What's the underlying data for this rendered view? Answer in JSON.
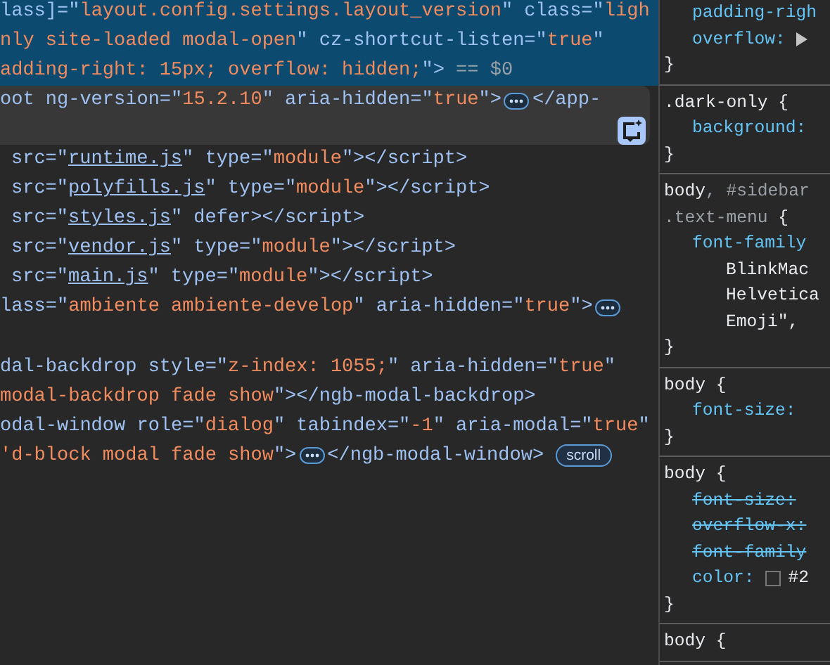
{
  "elements_panel": {
    "lines": [
      {
        "selected": true,
        "hovered": false,
        "indented": false,
        "blank_line_after": false,
        "tokens": [
          {
            "kind": "attr",
            "text": "lass]=\""
          },
          {
            "kind": "value",
            "text": "layout.config.settings.layout_version"
          },
          {
            "kind": "attr",
            "text": "\" class=\""
          },
          {
            "kind": "value",
            "text": "ligh"
          }
        ]
      },
      {
        "selected": true,
        "hovered": false,
        "indented": false,
        "blank_line_after": false,
        "tokens": [
          {
            "kind": "value",
            "text": "nly site-loaded modal-open"
          },
          {
            "kind": "attr",
            "text": "\" cz-shortcut-listen=\""
          },
          {
            "kind": "value",
            "text": "true"
          },
          {
            "kind": "attr",
            "text": "\""
          }
        ]
      },
      {
        "selected": true,
        "hovered": false,
        "indented": false,
        "blank_line_after": false,
        "tokens": [
          {
            "kind": "value",
            "text": "adding-right: 15px; overflow: hidden;"
          },
          {
            "kind": "attr",
            "text": "\">"
          },
          {
            "kind": "ref",
            "text": " == $0"
          }
        ]
      },
      {
        "selected": false,
        "hovered": true,
        "indented": false,
        "blank_line_after": false,
        "tokens": [
          {
            "kind": "attr",
            "text": "oot ng-version=\""
          },
          {
            "kind": "value",
            "text": "15.2.10"
          },
          {
            "kind": "attr",
            "text": "\" aria-hidden=\""
          },
          {
            "kind": "value",
            "text": "true"
          },
          {
            "kind": "attr",
            "text": "\">"
          },
          {
            "kind": "more"
          },
          {
            "kind": "tag",
            "text": "</app-"
          }
        ]
      },
      {
        "selected": false,
        "hovered": false,
        "indented": true,
        "blank_line_after": false,
        "tokens": [
          {
            "kind": "attr",
            "text": "src=\""
          },
          {
            "kind": "link",
            "text": "runtime.js"
          },
          {
            "kind": "attr",
            "text": "\" type=\""
          },
          {
            "kind": "value",
            "text": "module"
          },
          {
            "kind": "attr",
            "text": "\"></script>"
          }
        ]
      },
      {
        "selected": false,
        "hovered": false,
        "indented": true,
        "blank_line_after": false,
        "tokens": [
          {
            "kind": "attr",
            "text": "src=\""
          },
          {
            "kind": "link",
            "text": "polyfills.js"
          },
          {
            "kind": "attr",
            "text": "\" type=\""
          },
          {
            "kind": "value",
            "text": "module"
          },
          {
            "kind": "attr",
            "text": "\"></script>"
          }
        ]
      },
      {
        "selected": false,
        "hovered": false,
        "indented": true,
        "blank_line_after": false,
        "tokens": [
          {
            "kind": "attr",
            "text": "src=\""
          },
          {
            "kind": "link",
            "text": "styles.js"
          },
          {
            "kind": "attr",
            "text": "\" defer></script>"
          }
        ]
      },
      {
        "selected": false,
        "hovered": false,
        "indented": true,
        "blank_line_after": false,
        "tokens": [
          {
            "kind": "attr",
            "text": "src=\""
          },
          {
            "kind": "link",
            "text": "vendor.js"
          },
          {
            "kind": "attr",
            "text": "\" type=\""
          },
          {
            "kind": "value",
            "text": "module"
          },
          {
            "kind": "attr",
            "text": "\"></script>"
          }
        ]
      },
      {
        "selected": false,
        "hovered": false,
        "indented": true,
        "blank_line_after": false,
        "tokens": [
          {
            "kind": "attr",
            "text": "src=\""
          },
          {
            "kind": "link",
            "text": "main.js"
          },
          {
            "kind": "attr",
            "text": "\" type=\""
          },
          {
            "kind": "value",
            "text": "module"
          },
          {
            "kind": "attr",
            "text": "\"></script>"
          }
        ]
      },
      {
        "selected": false,
        "hovered": false,
        "indented": false,
        "blank_line_after": true,
        "tokens": [
          {
            "kind": "attr",
            "text": "lass=\""
          },
          {
            "kind": "value",
            "text": "ambiente ambiente-develop"
          },
          {
            "kind": "attr",
            "text": "\" aria-hidden=\""
          },
          {
            "kind": "value",
            "text": "true"
          },
          {
            "kind": "attr",
            "text": "\">"
          },
          {
            "kind": "more"
          }
        ]
      },
      {
        "selected": false,
        "hovered": false,
        "indented": false,
        "blank_line_after": false,
        "tokens": [
          {
            "kind": "attr",
            "text": "dal-backdrop style=\""
          },
          {
            "kind": "value",
            "text": "z-index: 1055;"
          },
          {
            "kind": "attr",
            "text": "\" aria-hidden=\""
          },
          {
            "kind": "value",
            "text": "true"
          },
          {
            "kind": "attr",
            "text": "\""
          }
        ]
      },
      {
        "selected": false,
        "hovered": false,
        "indented": false,
        "blank_line_after": false,
        "tokens": [
          {
            "kind": "value",
            "text": "modal-backdrop fade show"
          },
          {
            "kind": "attr",
            "text": "\"></ngb-modal-backdrop>"
          }
        ]
      },
      {
        "selected": false,
        "hovered": false,
        "indented": false,
        "blank_line_after": false,
        "tokens": [
          {
            "kind": "attr",
            "text": "odal-window role=\""
          },
          {
            "kind": "value",
            "text": "dialog"
          },
          {
            "kind": "attr",
            "text": "\" tabindex=\""
          },
          {
            "kind": "value",
            "text": "-1"
          },
          {
            "kind": "attr",
            "text": "\" aria-modal=\""
          },
          {
            "kind": "value",
            "text": "true"
          },
          {
            "kind": "attr",
            "text": "\""
          }
        ]
      },
      {
        "selected": false,
        "hovered": false,
        "indented": false,
        "blank_line_after": false,
        "tokens": [
          {
            "kind": "value",
            "text": "'d-block modal fade show"
          },
          {
            "kind": "attr",
            "text": "\">"
          },
          {
            "kind": "more"
          },
          {
            "kind": "tag",
            "text": "</ngb-modal-window>"
          },
          {
            "kind": "badge",
            "text": "scroll"
          }
        ]
      }
    ]
  },
  "styles_panel": {
    "rules": [
      {
        "lines": [
          {
            "kind": "decl",
            "parts": [
              {
                "kind": "prop",
                "text": "padding-righ"
              }
            ]
          },
          {
            "kind": "decl",
            "parts": [
              {
                "kind": "prop",
                "text": "overflow:"
              },
              {
                "kind": "expand"
              }
            ]
          },
          {
            "kind": "close",
            "parts": [
              {
                "kind": "brace",
                "text": "}"
              }
            ]
          }
        ]
      },
      {
        "lines": [
          {
            "kind": "sel",
            "parts": [
              {
                "kind": "sel",
                "text": ".dark-only {"
              }
            ]
          },
          {
            "kind": "decl",
            "parts": [
              {
                "kind": "prop",
                "text": "background:"
              }
            ]
          },
          {
            "kind": "close",
            "parts": [
              {
                "kind": "brace",
                "text": "}"
              }
            ]
          }
        ]
      },
      {
        "lines": [
          {
            "kind": "sel",
            "parts": [
              {
                "kind": "sel",
                "text": "body"
              },
              {
                "kind": "dim",
                "text": ", #sidebar"
              }
            ]
          },
          {
            "kind": "sel",
            "parts": [
              {
                "kind": "dim",
                "text": ".text-menu"
              },
              {
                "kind": "sel",
                "text": " {"
              }
            ]
          },
          {
            "kind": "decl",
            "parts": [
              {
                "kind": "prop",
                "text": "font-family"
              }
            ]
          },
          {
            "kind": "cont",
            "parts": [
              {
                "kind": "plain",
                "text": "BlinkMac"
              }
            ]
          },
          {
            "kind": "cont",
            "parts": [
              {
                "kind": "plain",
                "text": "Helvetica"
              }
            ]
          },
          {
            "kind": "cont",
            "parts": [
              {
                "kind": "plain",
                "text": "Emoji\", "
              }
            ]
          },
          {
            "kind": "close",
            "parts": [
              {
                "kind": "brace",
                "text": "}"
              }
            ]
          }
        ]
      },
      {
        "lines": [
          {
            "kind": "sel",
            "parts": [
              {
                "kind": "sel",
                "text": "body {"
              }
            ]
          },
          {
            "kind": "decl",
            "parts": [
              {
                "kind": "prop",
                "text": "font-size:"
              }
            ]
          },
          {
            "kind": "close",
            "parts": [
              {
                "kind": "brace",
                "text": "}"
              }
            ]
          }
        ]
      },
      {
        "lines": [
          {
            "kind": "sel",
            "parts": [
              {
                "kind": "sel",
                "text": "body {"
              }
            ]
          },
          {
            "kind": "decl",
            "struck": true,
            "parts": [
              {
                "kind": "prop",
                "text": "font-size:"
              }
            ]
          },
          {
            "kind": "decl",
            "struck": true,
            "parts": [
              {
                "kind": "prop",
                "text": "overflow-x:"
              }
            ]
          },
          {
            "kind": "decl",
            "struck": true,
            "parts": [
              {
                "kind": "prop",
                "text": "font-family"
              }
            ]
          },
          {
            "kind": "decl",
            "struck": false,
            "parts": [
              {
                "kind": "prop",
                "text": "color:"
              },
              {
                "kind": "swatch"
              },
              {
                "kind": "plain",
                "text": "#2"
              }
            ]
          },
          {
            "kind": "close",
            "parts": [
              {
                "kind": "brace",
                "text": "}"
              }
            ]
          }
        ]
      },
      {
        "lines": [
          {
            "kind": "sel",
            "parts": [
              {
                "kind": "sel",
                "text": "body {"
              }
            ]
          }
        ]
      }
    ]
  }
}
